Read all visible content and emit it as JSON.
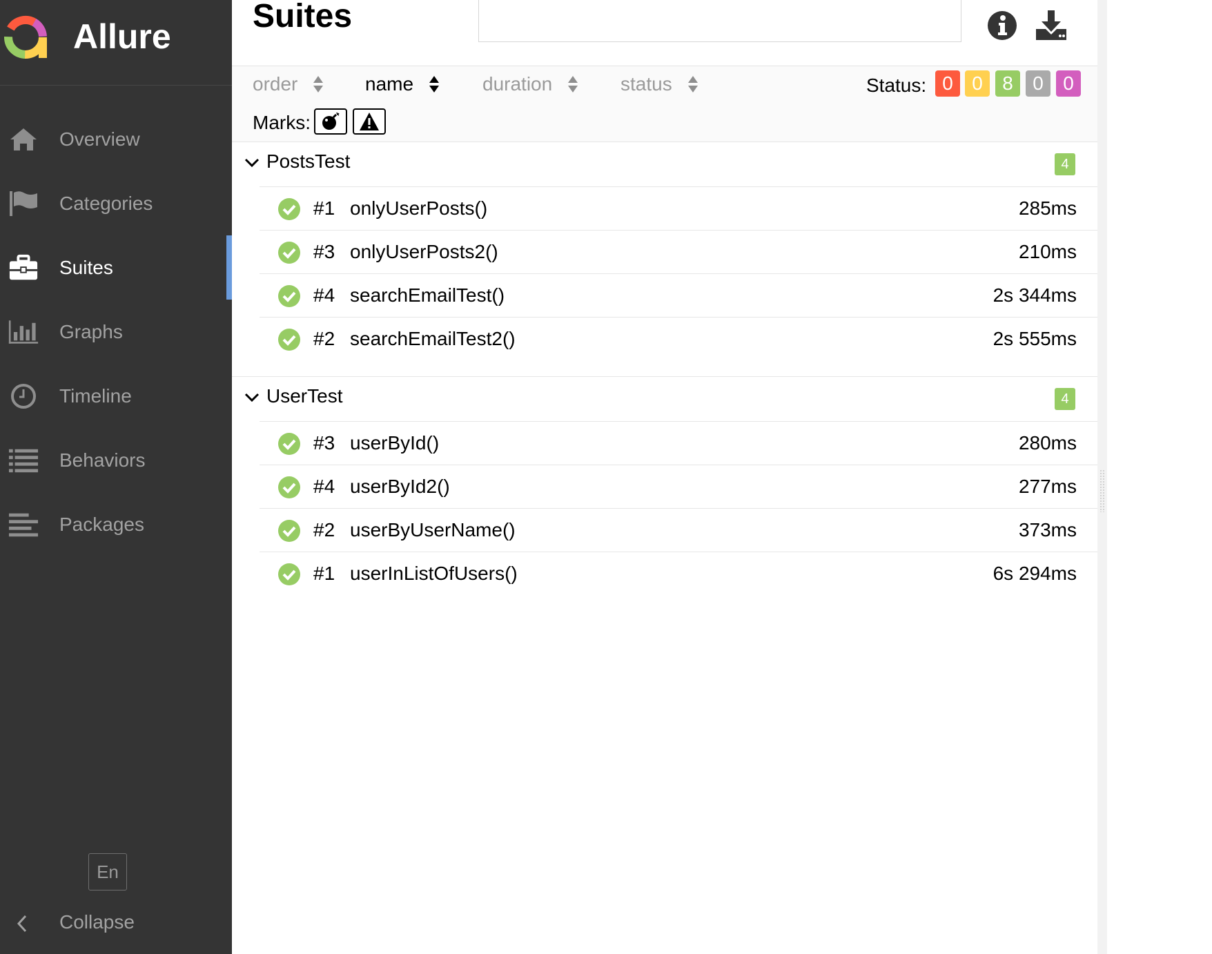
{
  "app": {
    "title": "Allure"
  },
  "sidebar": {
    "items": [
      {
        "label": "Overview",
        "icon": "home-icon",
        "active": false
      },
      {
        "label": "Categories",
        "icon": "flag-icon",
        "active": false
      },
      {
        "label": "Suites",
        "icon": "briefcase-icon",
        "active": true
      },
      {
        "label": "Graphs",
        "icon": "bar-chart-icon",
        "active": false
      },
      {
        "label": "Timeline",
        "icon": "clock-icon",
        "active": false
      },
      {
        "label": "Behaviors",
        "icon": "list-icon",
        "active": false
      },
      {
        "label": "Packages",
        "icon": "align-left-icon",
        "active": false
      }
    ],
    "language": "En",
    "collapse_label": "Collapse"
  },
  "page": {
    "title": "Suites",
    "search": {
      "value": "",
      "placeholder": ""
    }
  },
  "sorting": {
    "options": [
      {
        "label": "order",
        "active": false
      },
      {
        "label": "name",
        "active": true
      },
      {
        "label": "duration",
        "active": false
      },
      {
        "label": "status",
        "active": false
      }
    ]
  },
  "status_filter": {
    "label": "Status:",
    "counts": [
      {
        "name": "failed",
        "count": "0",
        "color": "#fd5a3e"
      },
      {
        "name": "broken",
        "count": "0",
        "color": "#ffd050"
      },
      {
        "name": "passed",
        "count": "8",
        "color": "#97cc64"
      },
      {
        "name": "skipped",
        "count": "0",
        "color": "#aaaaaa"
      },
      {
        "name": "unknown",
        "count": "0",
        "color": "#d35ebe"
      }
    ]
  },
  "marks": {
    "label": "Marks:",
    "items": [
      "flaky-bomb-icon",
      "warning-icon"
    ]
  },
  "groups": [
    {
      "name": "PostsTest",
      "count": "4",
      "tests": [
        {
          "number": "#1",
          "name": "onlyUserPosts()",
          "duration": "285ms",
          "status": "passed"
        },
        {
          "number": "#3",
          "name": "onlyUserPosts2()",
          "duration": "210ms",
          "status": "passed"
        },
        {
          "number": "#4",
          "name": "searchEmailTest()",
          "duration": "2s 344ms",
          "status": "passed"
        },
        {
          "number": "#2",
          "name": "searchEmailTest2()",
          "duration": "2s 555ms",
          "status": "passed"
        }
      ]
    },
    {
      "name": "UserTest",
      "count": "4",
      "tests": [
        {
          "number": "#3",
          "name": "userById()",
          "duration": "280ms",
          "status": "passed"
        },
        {
          "number": "#4",
          "name": "userById2()",
          "duration": "277ms",
          "status": "passed"
        },
        {
          "number": "#2",
          "name": "userByUserName()",
          "duration": "373ms",
          "status": "passed"
        },
        {
          "number": "#1",
          "name": "userInListOfUsers()",
          "duration": "6s 294ms",
          "status": "passed"
        }
      ]
    }
  ],
  "colors": {
    "sidebar_bg": "#343434",
    "accent": "#6a9bdc",
    "passed": "#97cc64"
  }
}
